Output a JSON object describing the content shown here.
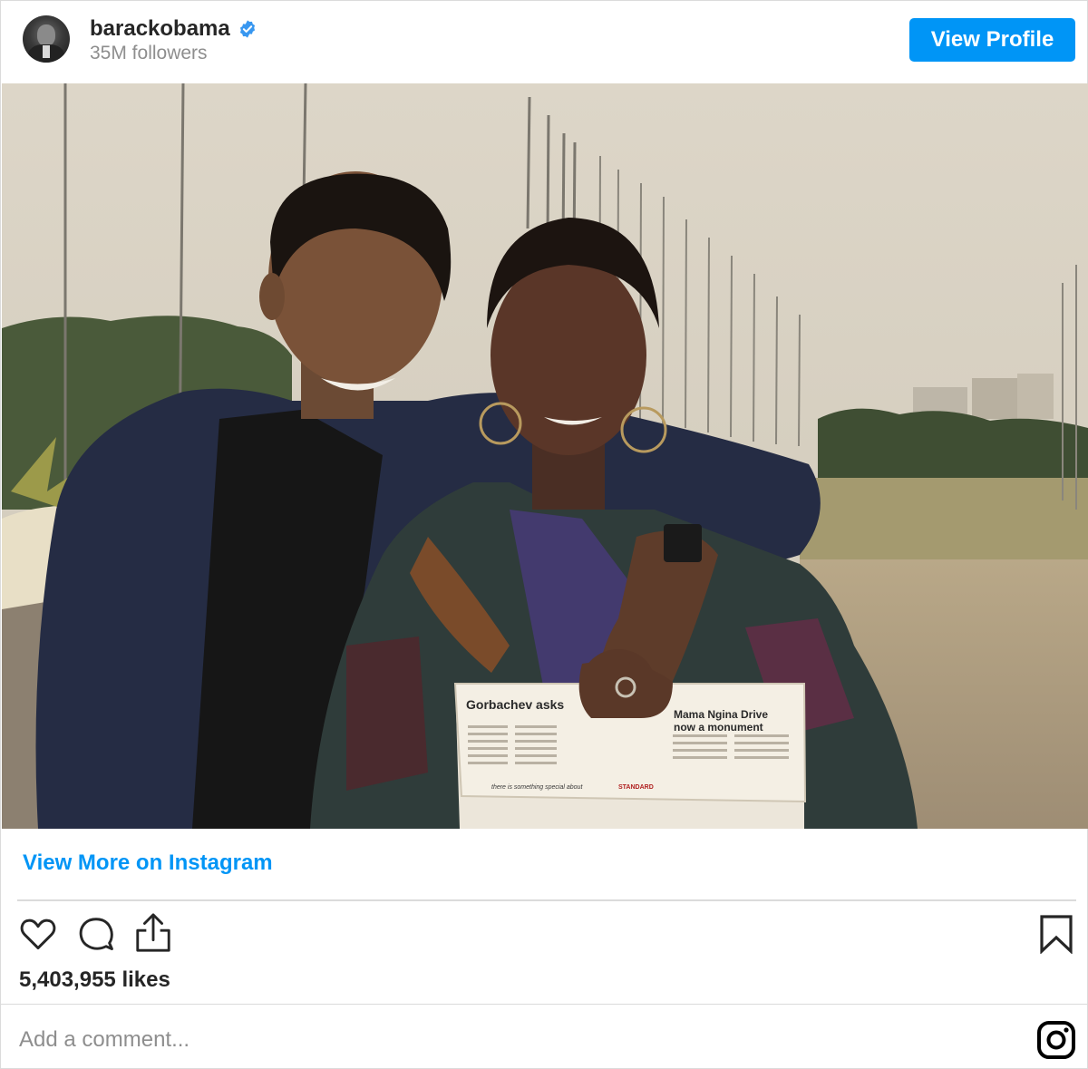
{
  "header": {
    "username": "barackobama",
    "followers": "35M followers",
    "view_profile_label": "View Profile"
  },
  "photo": {
    "newspaper_left_headline": "Gorbachev asks",
    "newspaper_right_headline_line1": "Mama Ngina Drive",
    "newspaper_right_headline_line2": "now a monument",
    "newspaper_footer": "there is something special about",
    "newspaper_brand": "STANDARD"
  },
  "links": {
    "view_more": "View More on Instagram"
  },
  "actions": {
    "likes": "5,403,955 likes"
  },
  "comment": {
    "placeholder": "Add a comment..."
  },
  "colors": {
    "accent": "#0095f6",
    "text": "#262626",
    "muted": "#8e8e8e",
    "border": "#dbdbdb"
  },
  "icons": [
    "verified-badge-icon",
    "heart-icon",
    "comment-icon",
    "share-icon",
    "bookmark-icon",
    "instagram-logo-icon"
  ]
}
